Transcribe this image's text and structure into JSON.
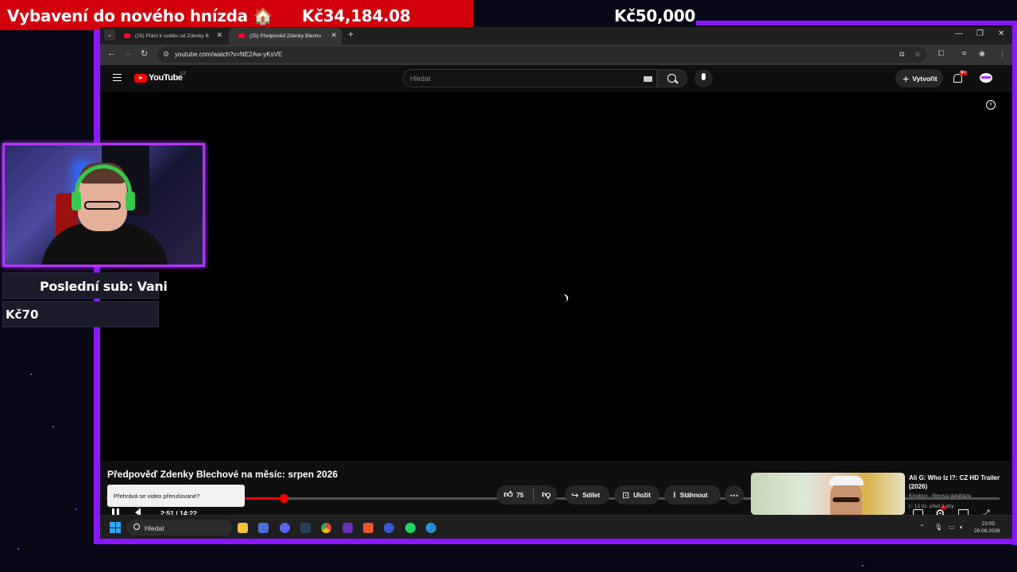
{
  "overlay": {
    "goal_title": "Vybavení do nového hnízda 🏠",
    "goal_current": "Kč34,184.08",
    "goal_target": "Kč50,000",
    "last_sub_label": "Poslední sub: Vani",
    "last_amount": "Kč70",
    "accent_color": "#8a16ff"
  },
  "browser": {
    "tabs": [
      {
        "label": "(25) Přání k svátku od Zdenky B",
        "active": false
      },
      {
        "label": "(25) Předpověď Zdenky Blecho",
        "active": true
      }
    ],
    "url": "youtube.com/watch?v=NE2Aw-yKsVE"
  },
  "youtube": {
    "logo_text": "YouTube",
    "region": "CZ",
    "search_placeholder": "Hledat",
    "create_label": "Vytvořit",
    "notification_count": "9+",
    "player": {
      "current_time": "2:51",
      "duration": "14:22",
      "time_display": "2:51 / 14:22",
      "progress_fraction": 0.198,
      "state": "loading"
    },
    "video_title": "Předpověď Zdenky Blechové na měsíc: srpen 2026",
    "tooltip": "Přehrává se video přerušované?",
    "like_count": "75",
    "share_label": "Sdílet",
    "save_label": "Uložit",
    "download_label": "Stáhnout",
    "recommendation": {
      "title": "Ali G: Who Iz I?: CZ HD Trailer (2026)",
      "channel": "Kinobox - filmová databáze",
      "views": "▷ 13 tis.",
      "age": "před 3 dny",
      "meta": "▷ 13 tis.   před 3 dny"
    }
  },
  "taskbar": {
    "search_label": "Hledat",
    "time": "23:05",
    "date": "28.08.2026"
  }
}
